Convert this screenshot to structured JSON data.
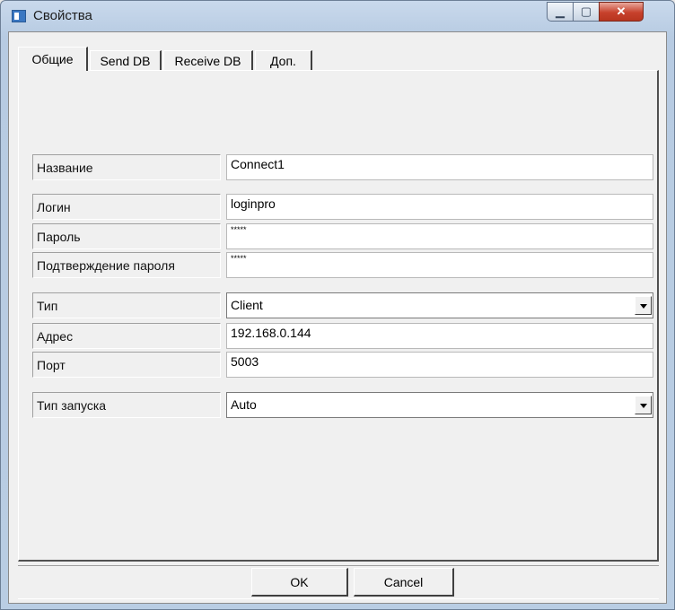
{
  "window": {
    "title": "Свойства"
  },
  "tabs": [
    {
      "label": "Общие",
      "active": true
    },
    {
      "label": "Send DB",
      "active": false
    },
    {
      "label": "Receive DB",
      "active": false
    },
    {
      "label": "Доп.",
      "active": false
    }
  ],
  "fields": {
    "name": {
      "label": "Название",
      "value": "Connect1"
    },
    "login": {
      "label": "Логин",
      "value": "loginpro"
    },
    "password": {
      "label": "Пароль",
      "value": "*****"
    },
    "confirm": {
      "label": "Подтверждение пароля",
      "value": "*****"
    },
    "type": {
      "label": "Тип",
      "value": "Client"
    },
    "address": {
      "label": "Адрес",
      "value": "192.168.0.144"
    },
    "port": {
      "label": "Порт",
      "value": "5003"
    },
    "start_type": {
      "label": "Тип запуска",
      "value": "Auto"
    }
  },
  "buttons": {
    "ok": "OK",
    "cancel": "Cancel"
  },
  "icons": {
    "window": "app-icon",
    "minimize": "minimize-icon",
    "maximize": "maximize-icon",
    "close": "close-icon",
    "dropdown": "chevron-down-icon"
  }
}
